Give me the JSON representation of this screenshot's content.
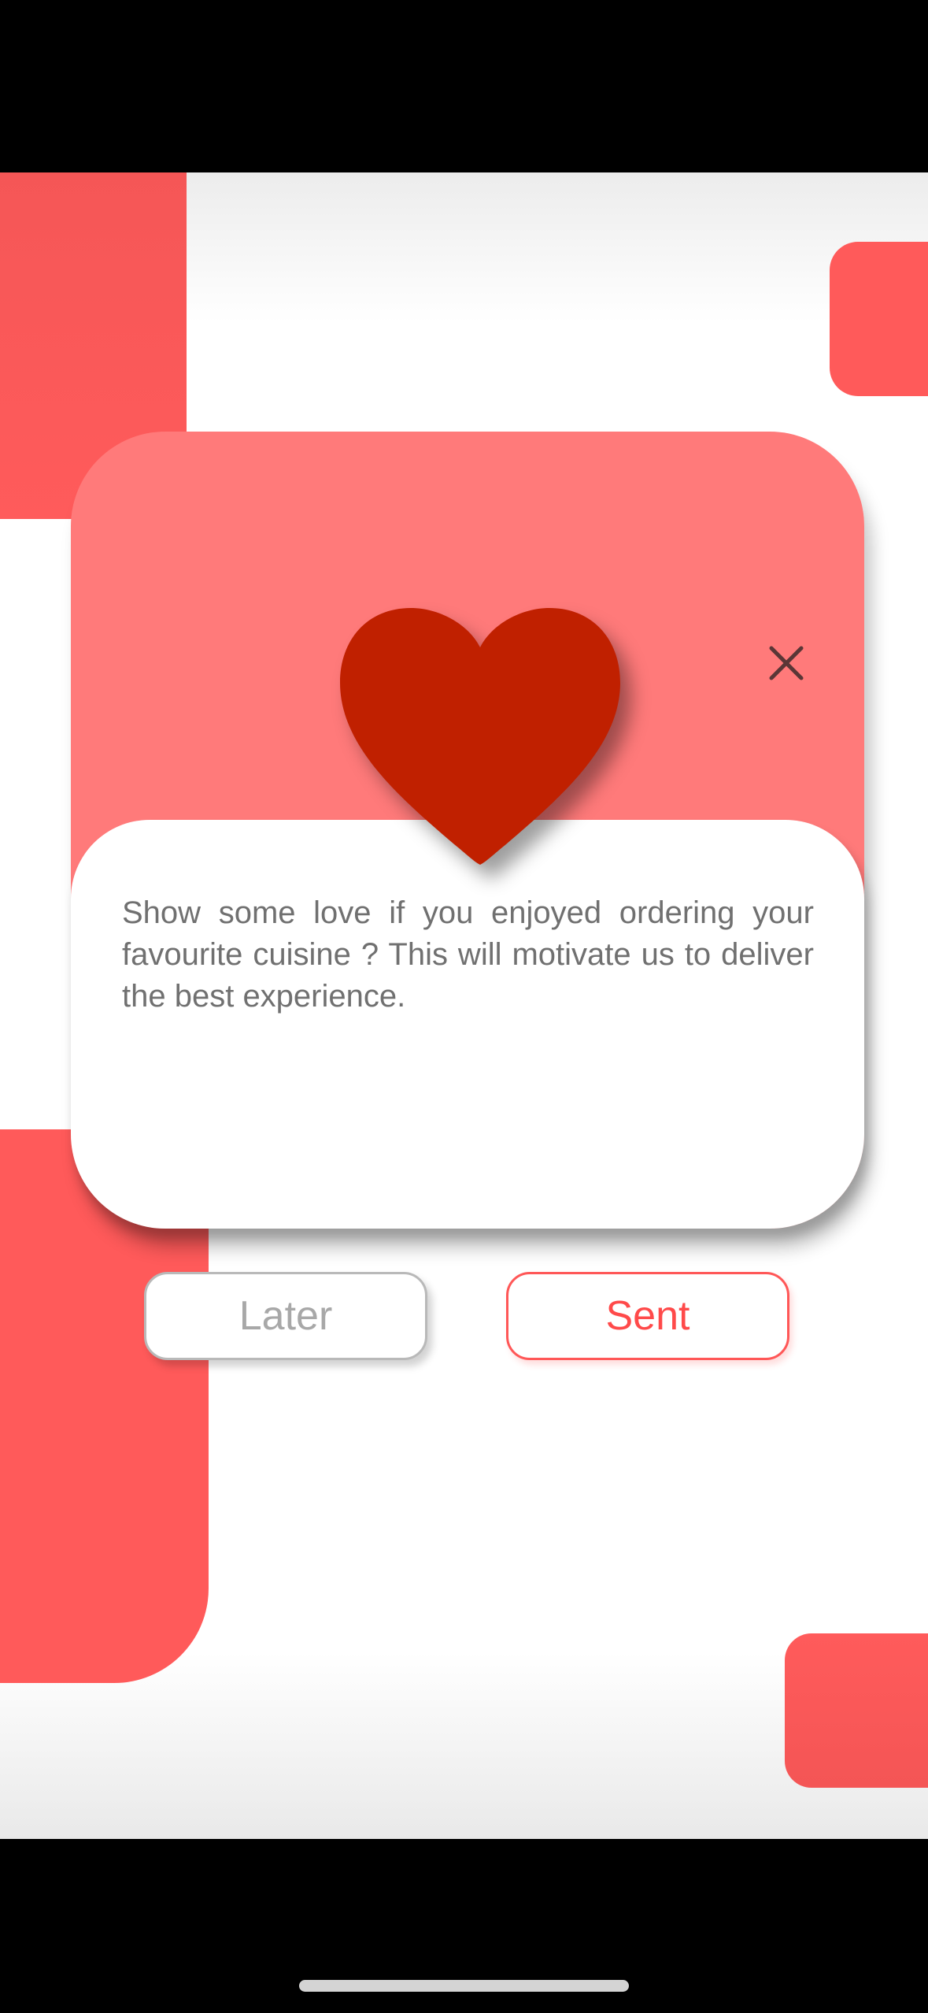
{
  "colors": {
    "accent": "#ff5a5a",
    "dialog_header": "#ff7a7a",
    "heart": "#c02000",
    "text": "#707070",
    "muted_border": "#b9b9b9"
  },
  "dialog": {
    "close_icon": "close-icon",
    "heart_icon": "heart-icon",
    "message": "Show some love if you enjoyed ordering your favourite cuisine ? This will motivate us to deliver the best experience.",
    "later_label": "Later",
    "sent_label": "Sent"
  }
}
